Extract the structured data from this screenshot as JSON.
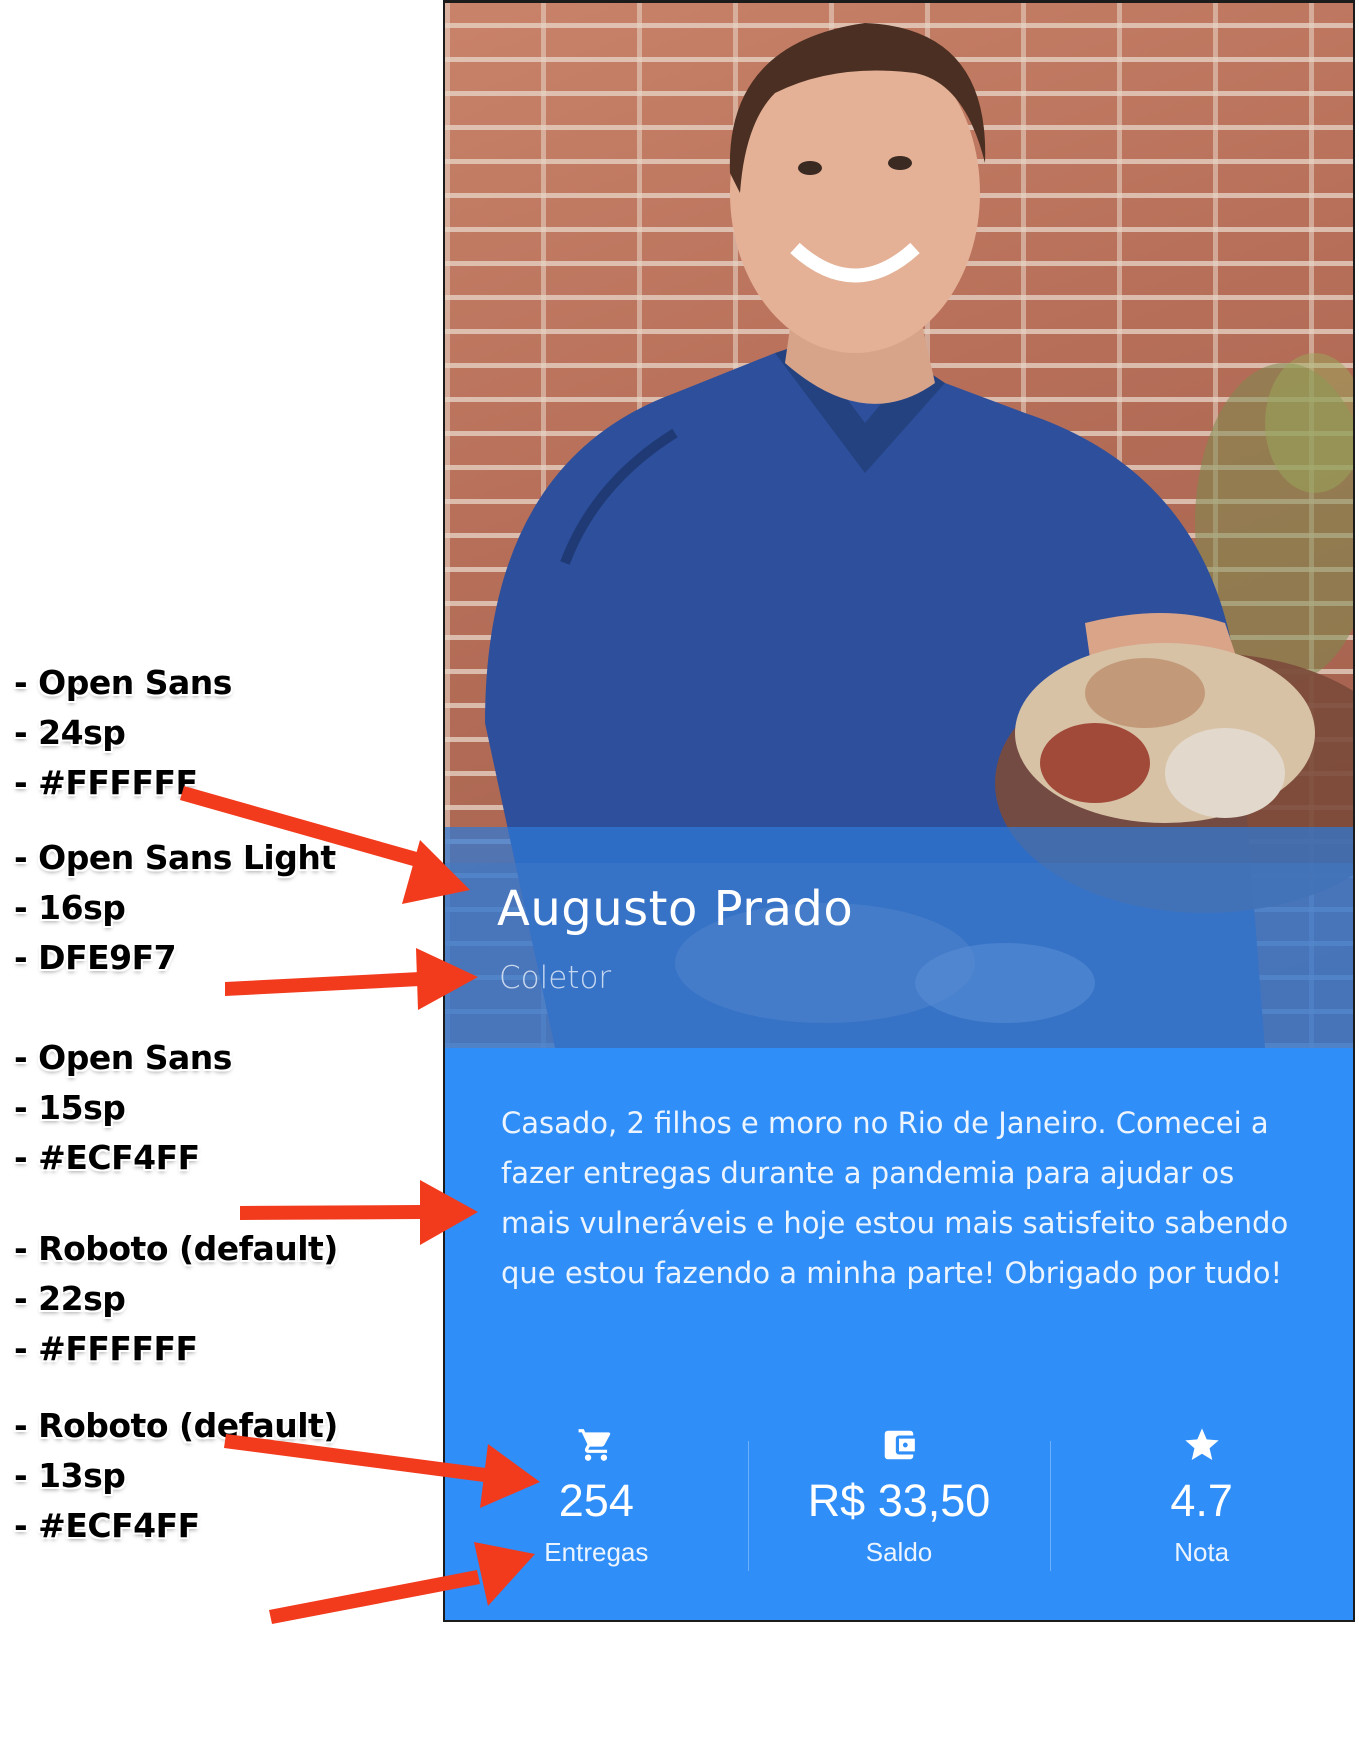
{
  "profile": {
    "name": "Augusto Prado",
    "role": "Coletor",
    "bio": "Casado, 2 filhos e moro no Rio de Janeiro. Comecei a fazer entregas durante a pandemia para ajudar os mais vulneráveis e hoje estou mais satisfeito sabendo que estou fazendo a minha parte! Obrigado por tudo!"
  },
  "stats": [
    {
      "icon": "cart-icon",
      "value": "254",
      "label": "Entregas"
    },
    {
      "icon": "wallet-icon",
      "value": "R$ 33,50",
      "label": "Saldo"
    },
    {
      "icon": "star-icon",
      "value": "4.7",
      "label": "Nota"
    }
  ],
  "annotations": [
    {
      "lines": [
        "- Open Sans",
        "- 24sp",
        "- #FFFFFF"
      ]
    },
    {
      "lines": [
        "- Open Sans Light",
        "- 16sp",
        "- DFE9F7"
      ]
    },
    {
      "lines": [
        "- Open Sans",
        "- 15sp",
        "- #ECF4FF"
      ]
    },
    {
      "lines": [
        "- Roboto (default)",
        "- 22sp",
        "- #FFFFFF"
      ]
    },
    {
      "lines": [
        "- Roboto (default)",
        "- 13sp",
        "- #ECF4FF"
      ]
    }
  ],
  "colors": {
    "card_background": "#2f8ef8",
    "overlay": "#2f78d6",
    "name_text": "#FFFFFF",
    "role_text": "#DFE9F7",
    "bio_text": "#ECF4FF",
    "arrow": "#f23a1c"
  }
}
